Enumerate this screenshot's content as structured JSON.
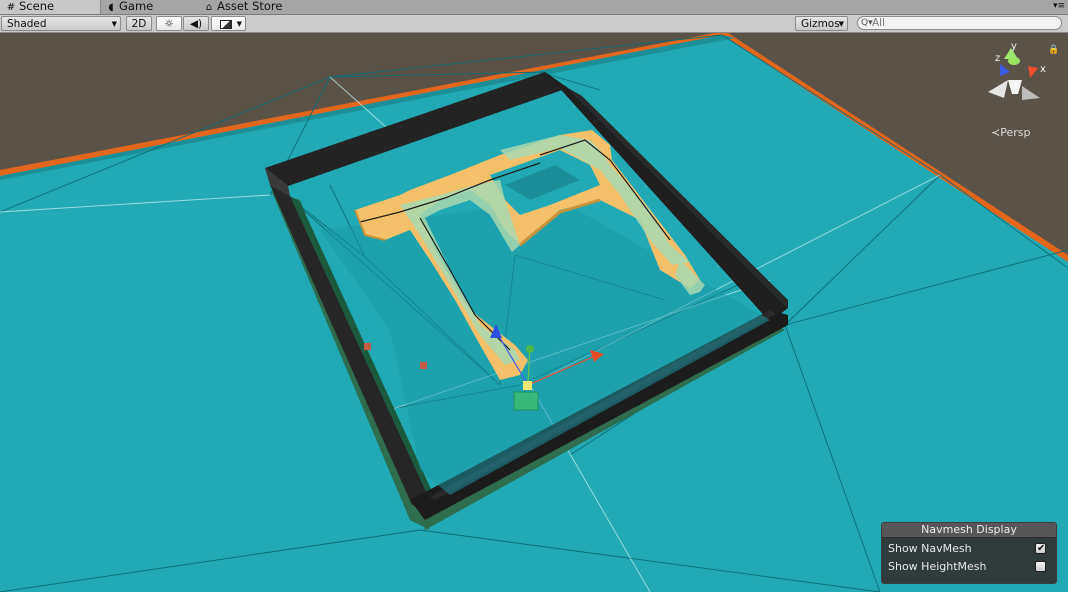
{
  "tabs": [
    {
      "label": "Scene",
      "icon": "grid-icon",
      "active": true
    },
    {
      "label": "Game",
      "icon": "pacman-icon",
      "active": false
    },
    {
      "label": "Asset Store",
      "icon": "store-icon",
      "active": false
    }
  ],
  "toolbar": {
    "draw_mode": "Shaded",
    "mode_2d": "2D",
    "gizmos_label": "Gizmos",
    "search_placeholder": "All"
  },
  "scene_gizmo": {
    "axes": [
      "y",
      "z",
      "x"
    ],
    "projection_label": "Persp"
  },
  "navmesh_display": {
    "title": "Navmesh Display",
    "options": [
      {
        "label": "Show NavMesh",
        "checked": true
      },
      {
        "label": "Show HeightMesh",
        "checked": false
      }
    ]
  },
  "colors": {
    "ground": "#1faab5",
    "wall": "#2b2b2b",
    "walkway": "#f4c06a",
    "background": "#5c5448",
    "edge_orange": "#e2661c"
  }
}
